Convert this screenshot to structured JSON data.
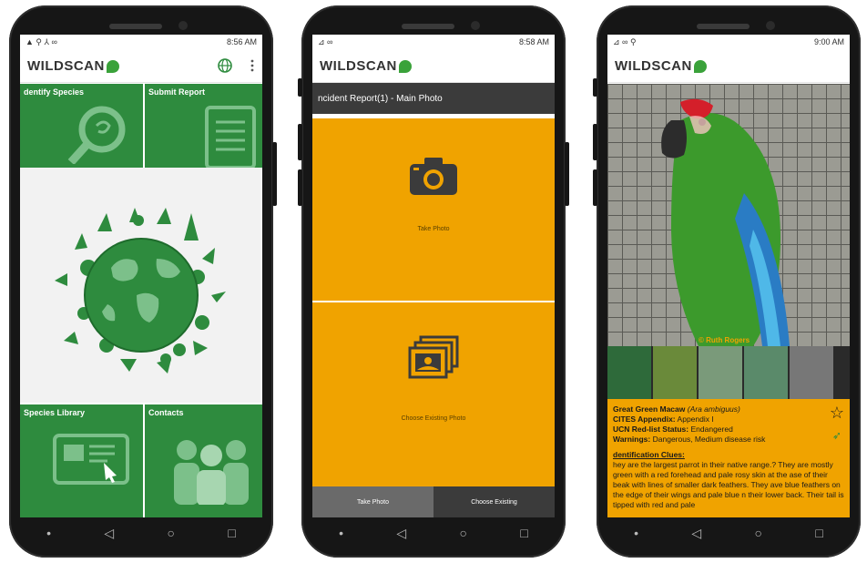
{
  "phones": [
    {
      "status_time": "8:56 AM",
      "app_name": "WILDSCAN",
      "tiles": [
        {
          "label": "dentify Species"
        },
        {
          "label": "Submit Report"
        },
        {
          "label": "Species Library"
        },
        {
          "label": "Contacts"
        }
      ],
      "icons": [
        "globe-icon",
        "more-vert-icon"
      ]
    },
    {
      "status_time": "8:58 AM",
      "app_name": "WILDSCAN",
      "header": "ncident Report(1) - Main Photo",
      "take_photo_label": "Take Photo",
      "choose_existing_label": "Choose Existing Photo",
      "tabs": [
        "Take Photo",
        "Choose Existing"
      ]
    },
    {
      "status_time": "9:00 AM",
      "app_name": "WILDSCAN",
      "photo_credit": "© Ruth Rogers",
      "species": {
        "common": "Great Green Macaw",
        "scientific": "(Ara ambiguus)",
        "cites_label": "CITES Appendix:",
        "cites_value": "Appendix I",
        "iucn_label": "UCN Red-list Status:",
        "iucn_value": "Endangered",
        "warnings_label": "Warnings:",
        "warnings_value": "Dangerous, Medium disease risk",
        "clues_title": "dentification Clues:",
        "clues_text": "hey are the largest parrot in their native range.? They are mostly green with a red forehead and pale rosy skin at the ase of their beak with lines of smaller dark feathers. They ave blue feathers on the edge of their wings and pale blue n their lower back. Their tail is tipped with red and pale"
      }
    }
  ],
  "colors": {
    "green": "#2e8b3e",
    "orange": "#f0a300",
    "dark": "#3b3b3b"
  }
}
